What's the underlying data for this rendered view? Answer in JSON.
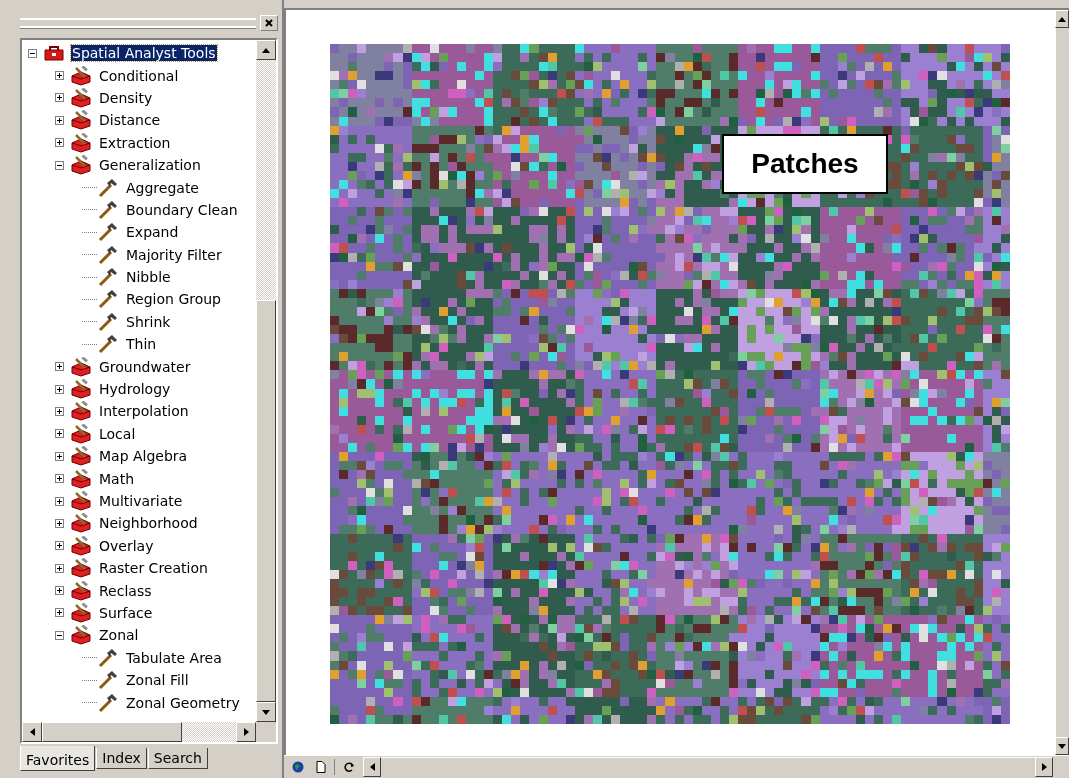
{
  "toolbox": {
    "label": "Spatial Analyst Tools",
    "kind": "toolbox",
    "expanded": true,
    "selected": true,
    "children": [
      {
        "label": "Conditional",
        "kind": "toolset",
        "expanded": false,
        "selected": false
      },
      {
        "label": "Density",
        "kind": "toolset",
        "expanded": false,
        "selected": false
      },
      {
        "label": "Distance",
        "kind": "toolset",
        "expanded": false,
        "selected": false
      },
      {
        "label": "Extraction",
        "kind": "toolset",
        "expanded": false,
        "selected": false
      },
      {
        "label": "Generalization",
        "kind": "toolset",
        "expanded": true,
        "selected": false,
        "children": [
          {
            "label": "Aggregate",
            "kind": "tool",
            "selected": false
          },
          {
            "label": "Boundary Clean",
            "kind": "tool",
            "selected": false
          },
          {
            "label": "Expand",
            "kind": "tool",
            "selected": false
          },
          {
            "label": "Majority Filter",
            "kind": "tool",
            "selected": false
          },
          {
            "label": "Nibble",
            "kind": "tool",
            "selected": false
          },
          {
            "label": "Region Group",
            "kind": "tool",
            "selected": false
          },
          {
            "label": "Shrink",
            "kind": "tool",
            "selected": false
          },
          {
            "label": "Thin",
            "kind": "tool",
            "selected": false
          }
        ]
      },
      {
        "label": "Groundwater",
        "kind": "toolset",
        "expanded": false,
        "selected": false
      },
      {
        "label": "Hydrology",
        "kind": "toolset",
        "expanded": false,
        "selected": false
      },
      {
        "label": "Interpolation",
        "kind": "toolset",
        "expanded": false,
        "selected": false
      },
      {
        "label": "Local",
        "kind": "toolset",
        "expanded": false,
        "selected": false
      },
      {
        "label": "Map Algebra",
        "kind": "toolset",
        "expanded": false,
        "selected": false
      },
      {
        "label": "Math",
        "kind": "toolset",
        "expanded": false,
        "selected": false
      },
      {
        "label": "Multivariate",
        "kind": "toolset",
        "expanded": false,
        "selected": false
      },
      {
        "label": "Neighborhood",
        "kind": "toolset",
        "expanded": false,
        "selected": false
      },
      {
        "label": "Overlay",
        "kind": "toolset",
        "expanded": false,
        "selected": false
      },
      {
        "label": "Raster Creation",
        "kind": "toolset",
        "expanded": false,
        "selected": false
      },
      {
        "label": "Reclass",
        "kind": "toolset",
        "expanded": false,
        "selected": false
      },
      {
        "label": "Surface",
        "kind": "toolset",
        "expanded": false,
        "selected": false
      },
      {
        "label": "Zonal",
        "kind": "toolset",
        "expanded": true,
        "selected": false,
        "children": [
          {
            "label": "Tabulate Area",
            "kind": "tool",
            "selected": false
          },
          {
            "label": "Zonal Fill",
            "kind": "tool",
            "selected": false
          },
          {
            "label": "Zonal Geometry",
            "kind": "tool",
            "selected": false
          }
        ]
      }
    ]
  },
  "tabs": [
    {
      "label": "Favorites",
      "selected": true
    },
    {
      "label": "Index",
      "selected": false
    },
    {
      "label": "Search",
      "selected": false
    }
  ],
  "map": {
    "label": "Patches"
  }
}
